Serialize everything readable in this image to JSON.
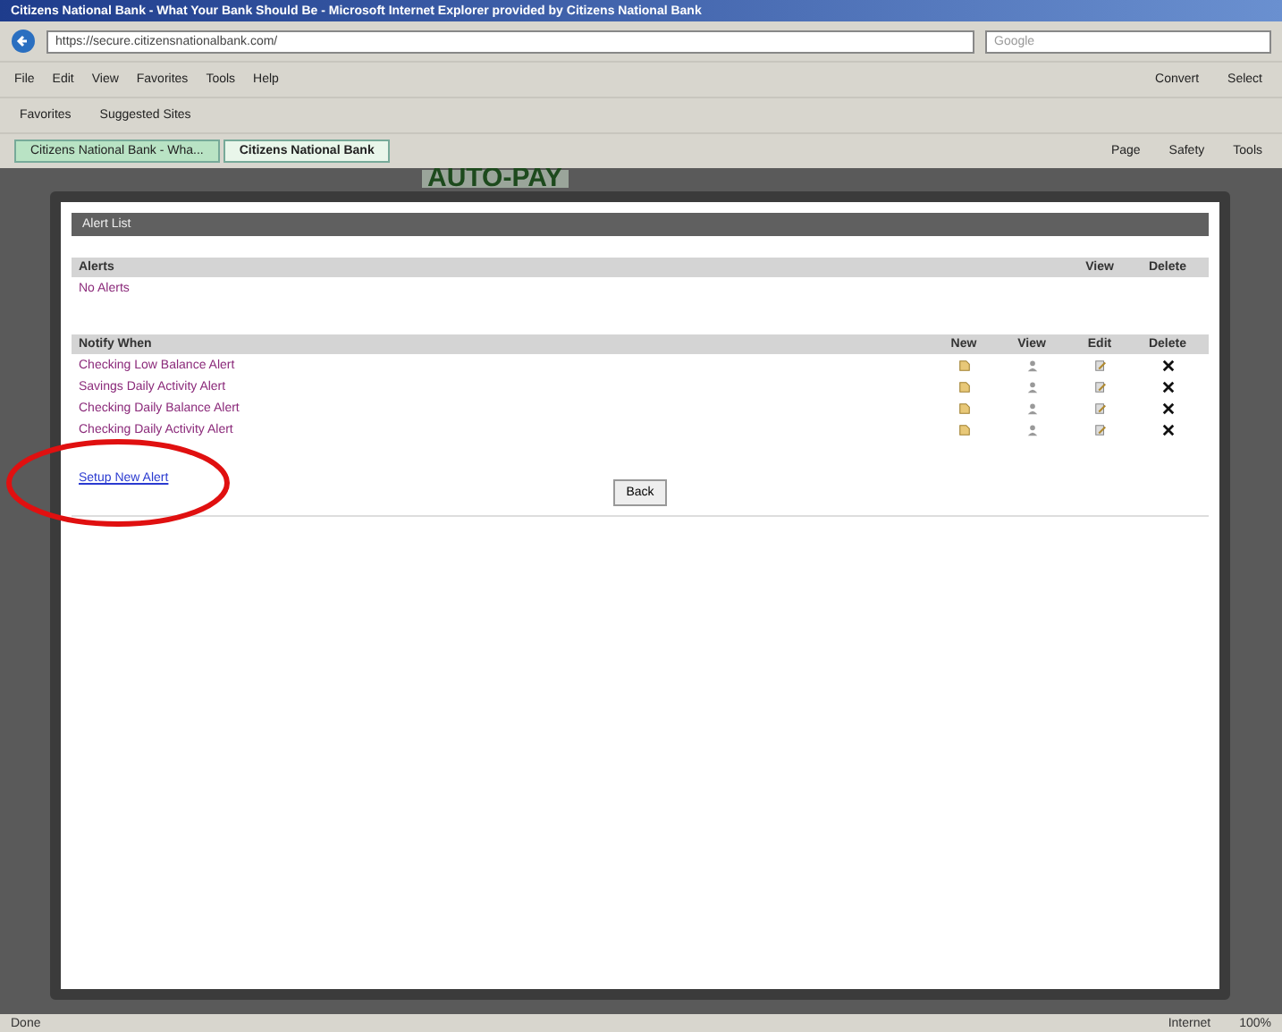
{
  "window": {
    "title": "Citizens National Bank - What Your Bank Should Be - Microsoft Internet Explorer provided by Citizens National Bank"
  },
  "address_bar": {
    "url": "https://secure.citizensnationalbank.com/"
  },
  "search": {
    "placeholder": "Google"
  },
  "menu": [
    "File",
    "Edit",
    "View",
    "Favorites",
    "Tools",
    "Help"
  ],
  "toolbar": [
    "Convert",
    "Select"
  ],
  "favorites_bar": [
    "Favorites",
    "Suggested Sites"
  ],
  "tabs": [
    {
      "label": "Citizens National Bank - Wha...",
      "selected": false
    },
    {
      "label": "Citizens National Bank",
      "selected": true
    }
  ],
  "command_bar": [
    "Page",
    "Safety",
    "Tools"
  ],
  "background_page": {
    "heading": "AUTO-PAY"
  },
  "dialog": {
    "title": "Alert List",
    "alerts": {
      "header": "Alerts",
      "columns": [
        "View",
        "Delete"
      ],
      "empty": "No Alerts"
    },
    "notify": {
      "header": "Notify When",
      "columns": [
        "New",
        "View",
        "Edit",
        "Delete"
      ],
      "rows": [
        "Checking Low Balance Alert",
        "Savings Daily Activity Alert",
        "Checking Daily Balance Alert",
        "Checking Daily Activity Alert"
      ]
    },
    "link": "Setup New Alert",
    "button": "Back"
  },
  "status_bar": {
    "status": "Done",
    "zone": "Internet",
    "zoom": "100%"
  }
}
